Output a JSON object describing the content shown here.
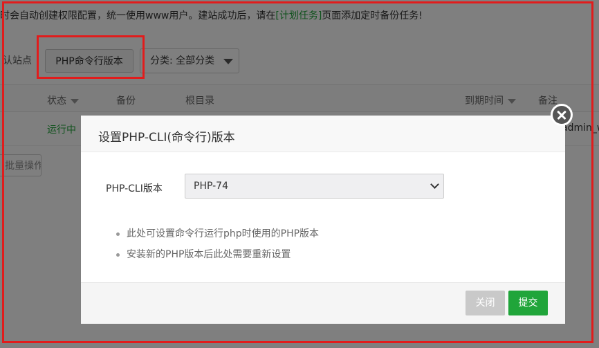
{
  "notice": {
    "prefix": "时会自动创建权限配置，统一使用www用户。建站成功后，请在",
    "link": "[计划任务]",
    "suffix": "页面添加定时备份任务!"
  },
  "toolbar": {
    "default_site_label": "认站点",
    "php_cli_button": "PHP命令行版本",
    "category_label": "分类: 全部分类"
  },
  "table": {
    "headers": {
      "status": "状态",
      "backup": "备份",
      "root": "根目录",
      "expire": "到期时间",
      "remark": "备注"
    },
    "row": {
      "status": "运行中",
      "remark": "admin_w"
    }
  },
  "batch_label": "批量操作",
  "modal": {
    "title": "设置PHP-CLI(命令行)版本",
    "field_label": "PHP-CLI版本",
    "selected_version": "PHP-74",
    "tips": [
      "此处可设置命令行运行php时使用的PHP版本",
      "安装新的PHP版本后此处需要重新设置"
    ],
    "close_button": "关闭",
    "submit_button": "提交"
  },
  "colors": {
    "accent_green": "#20a53a",
    "highlight_red": "#e11c1c"
  },
  "icons": {
    "dialog_close": "close-circle-icon",
    "select_arrow": "chevron-down-icon",
    "sort_arrow": "caret-down-icon"
  }
}
